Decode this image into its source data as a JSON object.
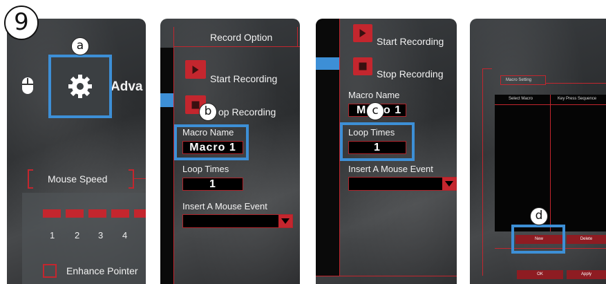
{
  "step_number": "9",
  "callouts": {
    "a": "a",
    "b": "b",
    "c": "c",
    "d": "d"
  },
  "panel1": {
    "advanced_label": "Adva",
    "mouse_speed_label": "Mouse Speed",
    "speed_ticks": [
      "1",
      "2",
      "3",
      "4"
    ],
    "enhance_pointer_label": "Enhance Pointer"
  },
  "panel2": {
    "record_option_title": "Record Option",
    "start_recording": "Start Recording",
    "stop_recording_partial": "op Recording",
    "macro_name_label": "Macro Name",
    "macro_name_value": "Macro 1",
    "loop_times_label": "Loop Times",
    "loop_times_value": "1",
    "insert_event_label": "Insert A Mouse Event"
  },
  "panel3": {
    "start_recording": "Start Recording",
    "stop_recording": "Stop Recording",
    "macro_name_label": "Macro Name",
    "macro_name_value_left": "M",
    "macro_name_value_right": "o 1",
    "loop_times_label": "Loop Times",
    "loop_times_value": "1",
    "insert_event_label": "Insert A Mouse Event"
  },
  "panel4": {
    "macro_setting_tab": "Macro Setting",
    "select_macro_header": "Select Macro",
    "key_press_header": "Key Press Sequence",
    "new_button": "New",
    "delete_button": "Delete",
    "ok_button": "OK",
    "apply_button": "Apply"
  },
  "colors": {
    "accent_red": "#c4262e",
    "highlight_blue": "#3d8fd6"
  }
}
